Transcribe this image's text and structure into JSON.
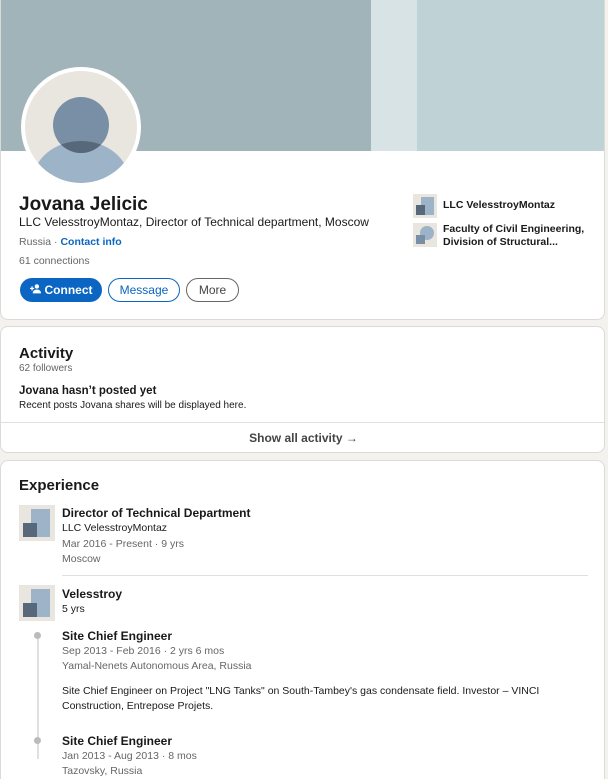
{
  "profile": {
    "name": "Jovana Jelicic",
    "headline": "LLC VelesstroyMontaz, Director of Technical department, Moscow",
    "location": "Russia",
    "separator": " · ",
    "contact_info": "Contact info",
    "connections": "61 connections",
    "buttons": {
      "connect": "Connect",
      "message": "Message",
      "more": "More"
    },
    "side": {
      "company": "LLC VelesstroyMontaz",
      "school": "Faculty of Civil Engineering, Division of Structural..."
    }
  },
  "activity": {
    "title": "Activity",
    "followers": "62 followers",
    "empty_title": "Jovana hasn’t posted yet",
    "empty_desc": "Recent posts Jovana shares will be displayed here.",
    "show_all": "Show all activity →"
  },
  "experience": {
    "title": "Experience",
    "items": [
      {
        "title": "Director of Technical Department",
        "company": "LLC VelesstroyMontaz",
        "dates": "Mar 2016 - Present · 9 yrs",
        "location": "Moscow"
      },
      {
        "company": "Velesstroy",
        "duration": "5 yrs",
        "roles": [
          {
            "title": "Site Chief Engineer",
            "dates": "Sep 2013 - Feb 2016 · 2 yrs 6 mos",
            "location": "Yamal-Nenets Autonomous Area, Russia",
            "description": "Site Chief Engineer on Project \"LNG Tanks\" on South-Tambey's gas condensate field. Investor – VINCI Construction, Entrepose Projets."
          },
          {
            "title": "Site Chief Engineer",
            "dates": "Jan 2013 - Aug 2013 · 8 mos",
            "location": "Tazovsky, Russia"
          }
        ]
      }
    ]
  },
  "icons": {
    "connect": "add-person-icon",
    "arrow": "arrow-right-icon"
  },
  "colors": {
    "accent": "#0a66c2",
    "banner": "#a0b4b9"
  }
}
